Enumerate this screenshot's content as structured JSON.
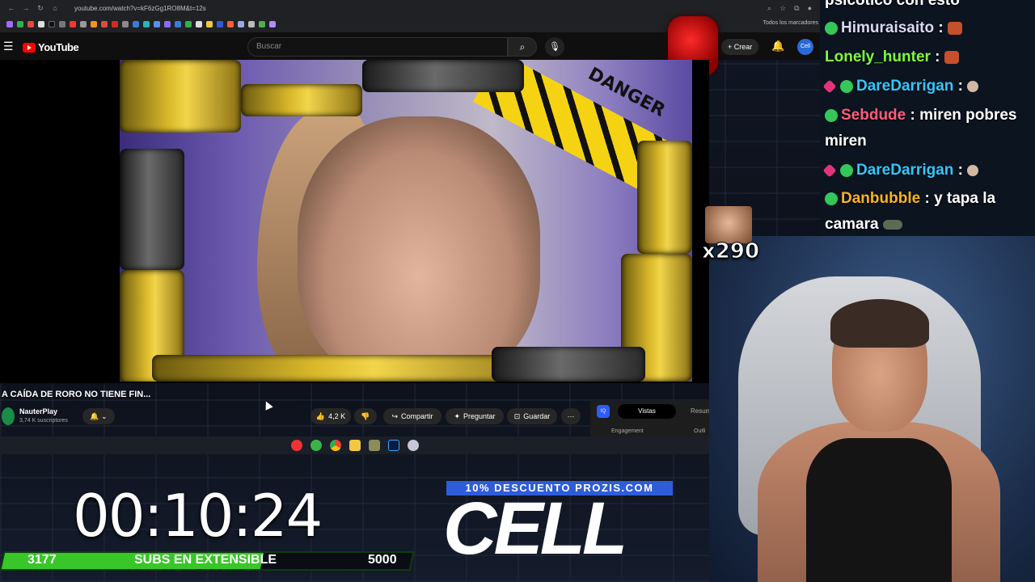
{
  "browser": {
    "url": "youtube.com/watch?v=kF6zGg1RO8M&t=12s",
    "bookmarks_label": "Todos los marcadores"
  },
  "youtube": {
    "brand": "YouTube",
    "search_placeholder": "Buscar",
    "create_label": "Crear",
    "avatar_label": "Cell"
  },
  "video": {
    "title": "A CAÍDA DE RORO NO TIENE FIN...",
    "channel": "NauterPlay",
    "subscribers": "3,74 K suscriptores",
    "likes": "4,2 K",
    "share": "Compartir",
    "ask": "Preguntar",
    "save": "Guardar",
    "danger_text": "DANGER"
  },
  "analytics": {
    "icon": "IQ",
    "tab_active": "Vistas",
    "tab_other": "Resum",
    "engagement": "Engagement",
    "outlier": "Outli"
  },
  "chat": [
    {
      "user": "psicotico con esto",
      "color": "#ffffff",
      "message": "",
      "badge": "none"
    },
    {
      "user": "Himuraisaito",
      "color": "#d9d9f2",
      "message": "",
      "badge": "sub"
    },
    {
      "user": "Lonely_hunter",
      "color": "#7cff3a",
      "message": "",
      "badge": "none"
    },
    {
      "user": "DareDarrigan",
      "color": "#33c7ff",
      "message": "",
      "badge": "gem"
    },
    {
      "user": "Sebdude",
      "color": "#ff5c7a",
      "message": "miren pobres",
      "badge": "sub"
    },
    {
      "user": "",
      "color": "#ffffff",
      "message": "miren",
      "badge": "none"
    },
    {
      "user": "DareDarrigan",
      "color": "#33c7ff",
      "message": "",
      "badge": "gem"
    },
    {
      "user": "Danbubble",
      "color": "#ffb31a",
      "message": "y tapa la",
      "badge": "sub"
    },
    {
      "user": "",
      "color": "#ffffff",
      "message": "camara",
      "badge": "none"
    }
  ],
  "emote": {
    "count": "x290"
  },
  "overlay": {
    "timer": "00:10:24",
    "subs_current": "3177",
    "subs_label": "SUBS EN EXTENSIBLE",
    "subs_goal": "5000",
    "subs_progress": 0.635,
    "promo": "10% DESCUENTO PROZIS.COM",
    "brand": "CELL"
  },
  "colors": {
    "youtube_red": "#ff0000",
    "subs_green": "#38c628",
    "promo_blue": "#2f5cd9"
  }
}
